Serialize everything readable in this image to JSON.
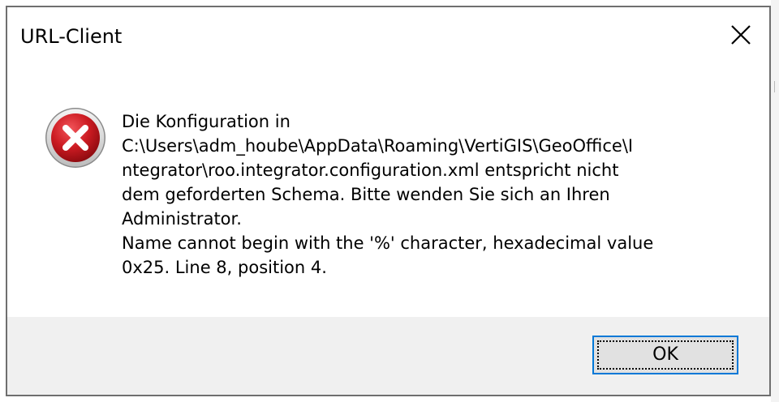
{
  "window": {
    "title": "URL-Client",
    "close_icon": "close-icon"
  },
  "message": {
    "icon": "error-icon",
    "lines": [
      "Die Konfiguration in",
      "C:\\Users\\adm_hoube\\AppData\\Roaming\\VertiGIS\\GeoOffice\\I",
      "ntegrator\\roo.integrator.configuration.xml entspricht nicht",
      "dem geforderten Schema. Bitte wenden Sie sich an Ihren",
      "Administrator.",
      "Name cannot begin with the '%' character, hexadecimal value",
      "0x25. Line 8, position 4."
    ]
  },
  "footer": {
    "ok_label": "OK"
  },
  "colors": {
    "icon_red": "#c8161d",
    "button_focus_border": "#0078d7",
    "footer_background": "#f0f0f0",
    "window_border": "#6f6f6f"
  }
}
